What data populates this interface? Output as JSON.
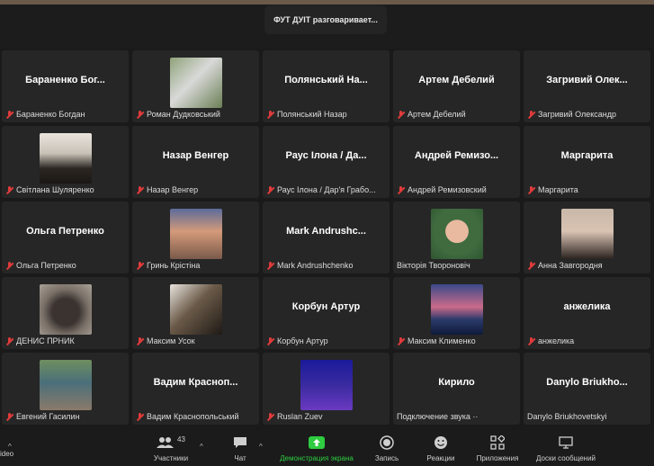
{
  "top": {
    "speaker": "ФУТ ДУІТ разговаривает..."
  },
  "tiles": [
    {
      "big": "Бараненко Бог...",
      "label": "Бараненко Богдан",
      "muted": true
    },
    {
      "big": "",
      "label": "Роман Дудковський",
      "muted": true
    },
    {
      "big": "Полянський На...",
      "label": "Полянський Назар",
      "muted": true
    },
    {
      "big": "Артем Дебелий",
      "label": "Артем Дебелий",
      "muted": true
    },
    {
      "big": "Загривий Олек...",
      "label": "Загривий Олександр",
      "muted": true
    },
    {
      "big": "",
      "label": "Світлана Шуляренко",
      "muted": true
    },
    {
      "big": "Назар Венгер",
      "label": "Назар Венгер",
      "muted": true
    },
    {
      "big": "Раус Ілона / Да...",
      "label": "Раус Ілона / Дар'я Грабо...",
      "muted": true
    },
    {
      "big": "Андрей Ремизо...",
      "label": "Андрей Ремизовский",
      "muted": true
    },
    {
      "big": "Маргарита",
      "label": "Маргарита",
      "muted": true
    },
    {
      "big": "Ольга Петренко",
      "label": "Ольга Петренко",
      "muted": true
    },
    {
      "big": "",
      "label": "Гринь Крістіна",
      "muted": true
    },
    {
      "big": "Mark Andrushc...",
      "label": "Mark Andrushchenko",
      "muted": true
    },
    {
      "big": "",
      "label": "Вікторія Твороновіч",
      "muted": false
    },
    {
      "big": "",
      "label": "Анна Завгородня",
      "muted": true
    },
    {
      "big": "",
      "label": "ДЕНИС ПРНИК",
      "muted": true
    },
    {
      "big": "",
      "label": "Максим Усок",
      "muted": true
    },
    {
      "big": "Корбун Артур",
      "label": "Корбун Артур",
      "muted": true
    },
    {
      "big": "",
      "label": "Максим Клименко",
      "muted": true
    },
    {
      "big": "анжелика",
      "label": "анжелика",
      "muted": true
    },
    {
      "big": "",
      "label": "Евгений Гасилин",
      "muted": true
    },
    {
      "big": "Вадим Красноп...",
      "label": "Вадим Краснопольський",
      "muted": true
    },
    {
      "big": "",
      "label": "Ruslan Zuev",
      "muted": true
    },
    {
      "big": "Кирило",
      "label": "Подключение звука ··",
      "muted": false
    },
    {
      "big": "Danylo Briukho...",
      "label": "Danylo Briukhovetskyi",
      "muted": false
    }
  ],
  "toolbar": {
    "video": "ideo",
    "participants": "Участники",
    "participants_count": "43",
    "chat": "Чат",
    "share": "Демонстрация экрана",
    "record": "Запись",
    "reactions": "Реакции",
    "apps": "Приложения",
    "whiteboards": "Доски сообщений"
  },
  "colors": {
    "share_green": "#2ecc40",
    "mute_red": "#e03b3b"
  }
}
